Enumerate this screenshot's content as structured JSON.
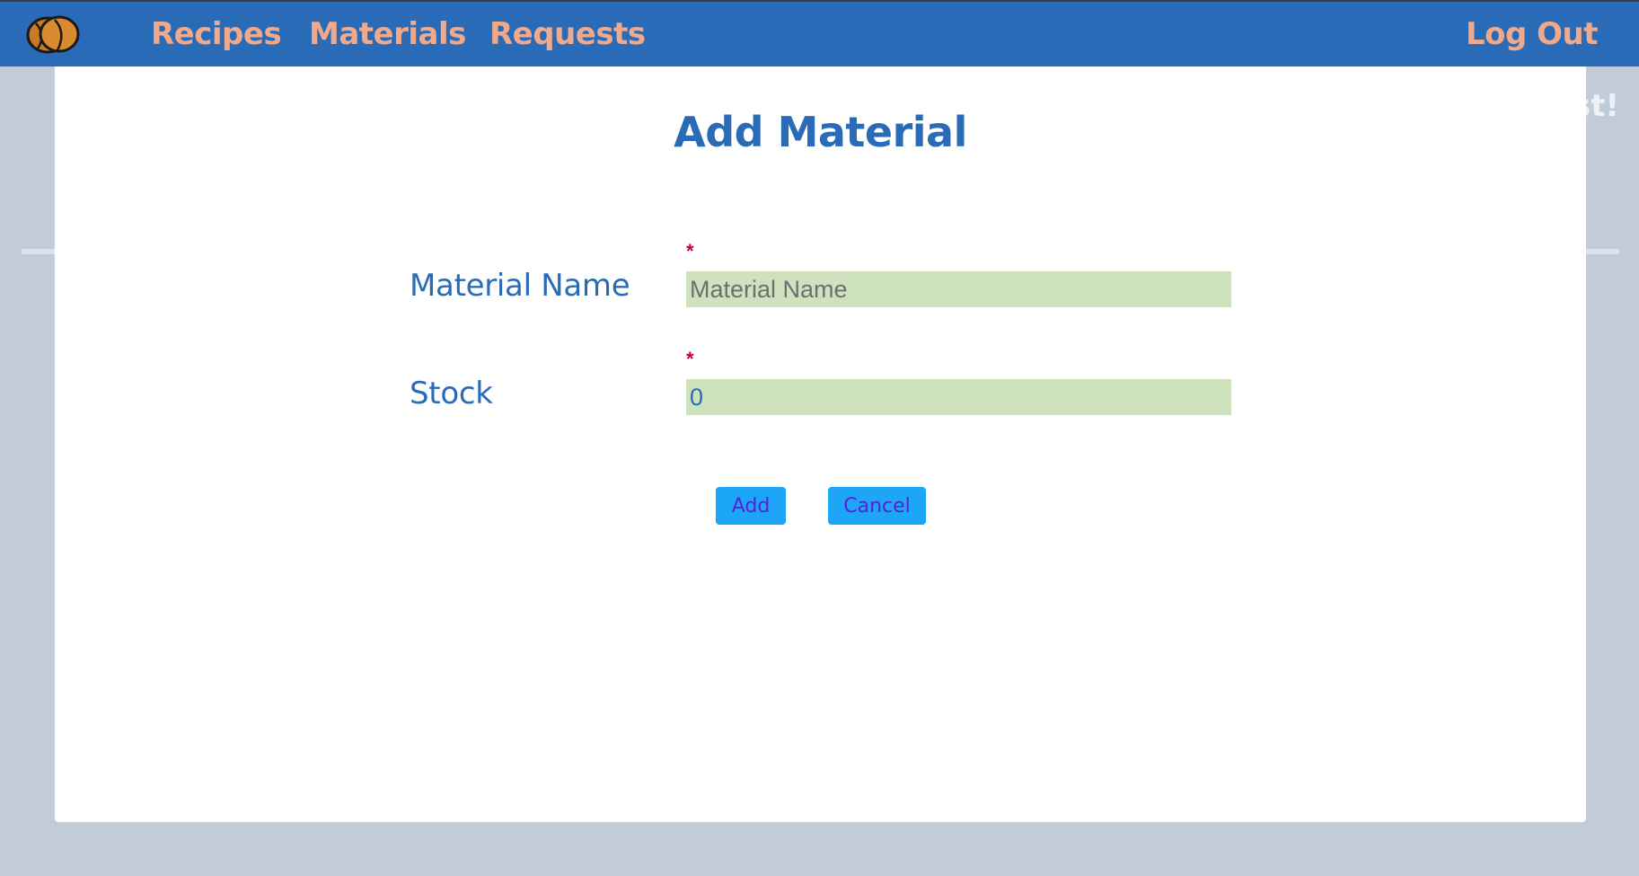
{
  "navbar": {
    "logo_icon": "bean-logo-icon",
    "links": {
      "recipes": "Recipes",
      "materials": "Materials",
      "requests": "Requests"
    },
    "logout": "Log Out",
    "colors": {
      "bar": "#2a6bb8",
      "link": "#f0a98a"
    }
  },
  "background": {
    "partial_text": "st!"
  },
  "modal": {
    "title": "Add Material",
    "fields": {
      "name": {
        "label": "Material Name",
        "required_mark": "*",
        "placeholder": "Material Name",
        "value": ""
      },
      "stock": {
        "label": "Stock",
        "required_mark": "*",
        "placeholder": "",
        "value": "0"
      }
    },
    "buttons": {
      "add": "Add",
      "cancel": "Cancel"
    },
    "colors": {
      "title": "#2a6bb8",
      "input_bg": "#cee2bd",
      "button_bg": "#1ca6f5",
      "button_text": "#5a1fd6",
      "required": "#cc0033"
    }
  }
}
